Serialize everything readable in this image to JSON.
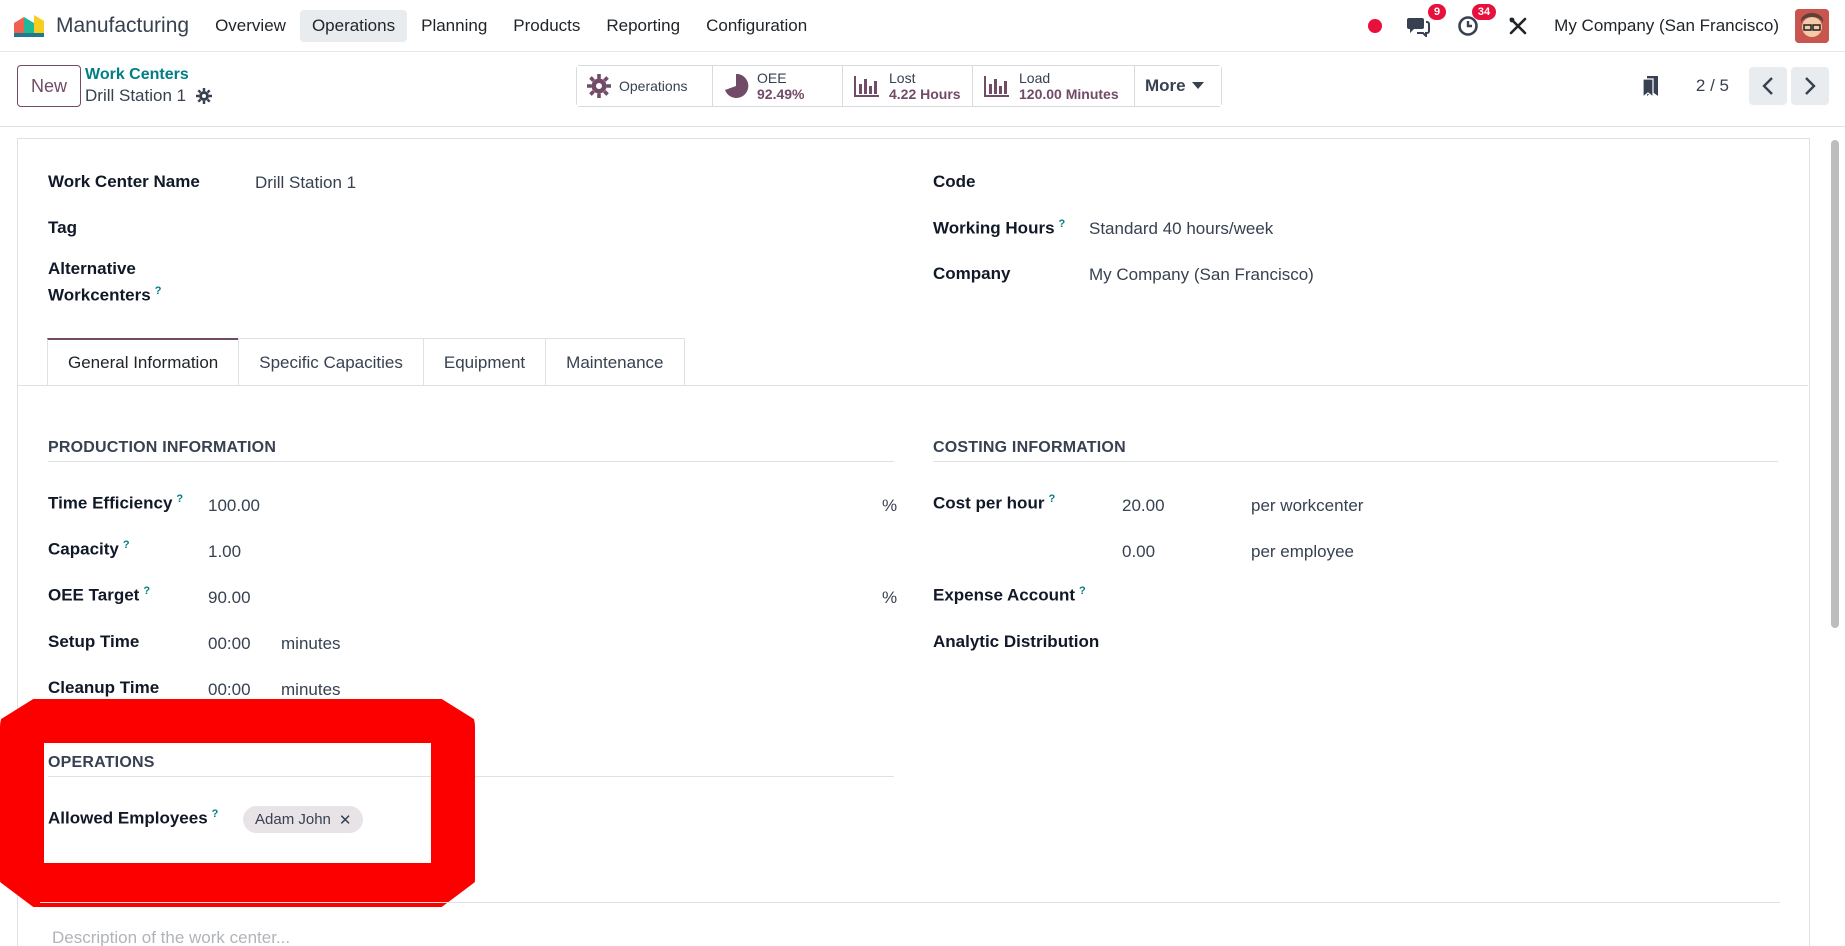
{
  "app": {
    "name": "Manufacturing"
  },
  "menu": [
    "Overview",
    "Operations",
    "Planning",
    "Products",
    "Reporting",
    "Configuration"
  ],
  "menu_active": "Operations",
  "navbar": {
    "messages_count": "9",
    "activities_count": "34",
    "company": "My Company (San Francisco)"
  },
  "control": {
    "new_label": "New",
    "breadcrumb_parent": "Work Centers",
    "breadcrumb_current": "Drill Station 1",
    "smart_buttons": {
      "operations": "Operations",
      "oee_label": "OEE",
      "oee_value": "92.49%",
      "lost_label": "Lost",
      "lost_value": "4.22 Hours",
      "load_label": "Load",
      "load_value": "120.00 Minutes",
      "more": "More"
    },
    "pager": "2 / 5"
  },
  "form": {
    "work_center_name_label": "Work Center Name",
    "work_center_name": "Drill Station 1",
    "tag_label": "Tag",
    "alternative_label_1": "Alternative",
    "alternative_label_2": "Workcenters",
    "code_label": "Code",
    "working_hours_label": "Working Hours",
    "working_hours": "Standard 40 hours/week",
    "company_label": "Company",
    "company": "My Company (San Francisco)"
  },
  "tabs": [
    "General Information",
    "Specific Capacities",
    "Equipment",
    "Maintenance"
  ],
  "production": {
    "title": "PRODUCTION INFORMATION",
    "time_efficiency_label": "Time Efficiency",
    "time_efficiency": "100.00",
    "time_efficiency_unit": "%",
    "capacity_label": "Capacity",
    "capacity": "1.00",
    "oee_target_label": "OEE Target",
    "oee_target": "90.00",
    "oee_target_unit": "%",
    "setup_time_label": "Setup Time",
    "setup_time": "00:00",
    "setup_unit": "minutes",
    "cleanup_time_label": "Cleanup Time",
    "cleanup_time": "00:00",
    "cleanup_unit": "minutes"
  },
  "costing": {
    "title": "COSTING INFORMATION",
    "cost_per_hour_label": "Cost per hour",
    "cost_per_hour": "20.00",
    "per_workcenter": "per workcenter",
    "employee_cost": "0.00",
    "per_employee": "per employee",
    "expense_account_label": "Expense Account",
    "analytic_label": "Analytic Distribution"
  },
  "operations": {
    "title": "OPERATIONS",
    "allowed_employees_label": "Allowed Employees",
    "employee_tag": "Adam John"
  },
  "description_placeholder": "Description of the work center...",
  "help_mark": "?"
}
